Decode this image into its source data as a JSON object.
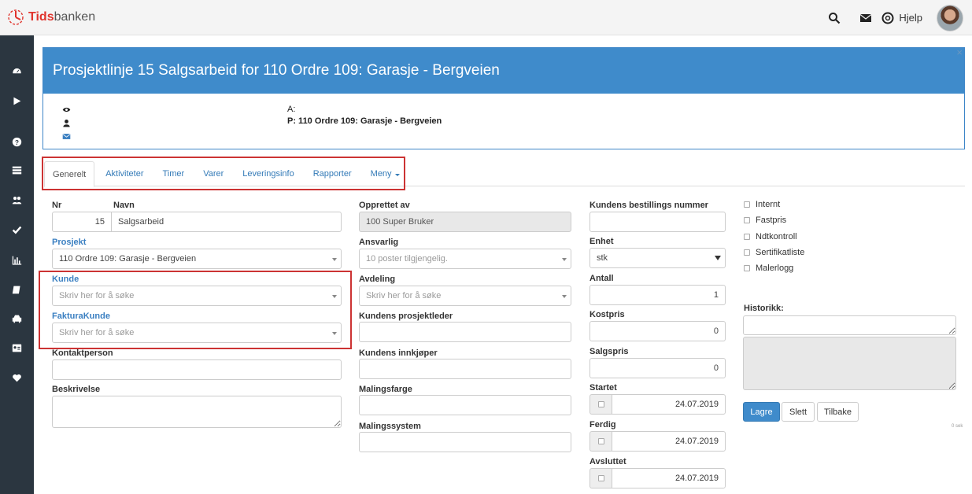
{
  "app": {
    "brand_bold": "Tids",
    "brand_rest": "banken",
    "help_label": "Hjelp"
  },
  "header": {
    "title": "Prosjektlinje 15 Salgsarbeid for 110 Ordre 109: Garasje - Bergveien",
    "close": "×",
    "line_a": "A:",
    "line_p": "P: 110 Ordre 109: Garasje - Bergveien"
  },
  "tabs": [
    {
      "label": "Generelt"
    },
    {
      "label": "Aktiviteter"
    },
    {
      "label": "Timer"
    },
    {
      "label": "Varer"
    },
    {
      "label": "Leveringsinfo"
    },
    {
      "label": "Rapporter"
    },
    {
      "label": "Meny"
    }
  ],
  "form": {
    "nr_label": "Nr",
    "nr_value": "15",
    "navn_label": "Navn",
    "navn_value": "Salgsarbeid",
    "prosjekt_label": "Prosjekt",
    "prosjekt_value": "110 Ordre 109: Garasje - Bergveien",
    "kunde_label": "Kunde",
    "kunde_placeholder": "Skriv her for å søke",
    "fakturakunde_label": "FakturaKunde",
    "fakturakunde_placeholder": "Skriv her for å søke",
    "kontaktperson_label": "Kontaktperson",
    "beskrivelse_label": "Beskrivelse",
    "opprettet_label": "Opprettet av",
    "opprettet_value": "100 Super Bruker",
    "ansvarlig_label": "Ansvarlig",
    "ansvarlig_value": "10 poster tilgjengelig.",
    "avdeling_label": "Avdeling",
    "avdeling_placeholder": "Skriv her for å søke",
    "prosjektleder_label": "Kundens prosjektleder",
    "innkjoper_label": "Kundens innkjøper",
    "malingsfarge_label": "Malingsfarge",
    "malingssystem_label": "Malingssystem",
    "bestillingsnr_label": "Kundens bestillings nummer",
    "enhet_label": "Enhet",
    "enhet_value": "stk",
    "antall_label": "Antall",
    "antall_value": "1",
    "kostpris_label": "Kostpris",
    "kostpris_value": "0",
    "salgspris_label": "Salgspris",
    "salgspris_value": "0",
    "startet_label": "Startet",
    "startet_value": "24.07.2019",
    "ferdig_label": "Ferdig",
    "ferdig_value": "24.07.2019",
    "avsluttet_label": "Avsluttet",
    "avsluttet_value": "24.07.2019"
  },
  "checkboxes": [
    {
      "label": "Internt"
    },
    {
      "label": "Fastpris"
    },
    {
      "label": "Ndtkontroll"
    },
    {
      "label": "Sertifikatliste"
    },
    {
      "label": "Malerlogg"
    }
  ],
  "historikk_label": "Historikk:",
  "buttons": {
    "save": "Lagre",
    "delete": "Slett",
    "back": "Tilbake"
  },
  "timing": "0 sek",
  "colors": {
    "accent": "#3f8bcb",
    "sidebar": "#2b3640",
    "highlight": "#cc3333"
  },
  "icons": {
    "sidebar": [
      "dashboard-icon",
      "play-icon",
      "question-icon",
      "list-icon",
      "users-icon",
      "check-icon",
      "bar-chart-icon",
      "book-icon",
      "car-icon",
      "id-card-icon",
      "heart-icon"
    ]
  }
}
